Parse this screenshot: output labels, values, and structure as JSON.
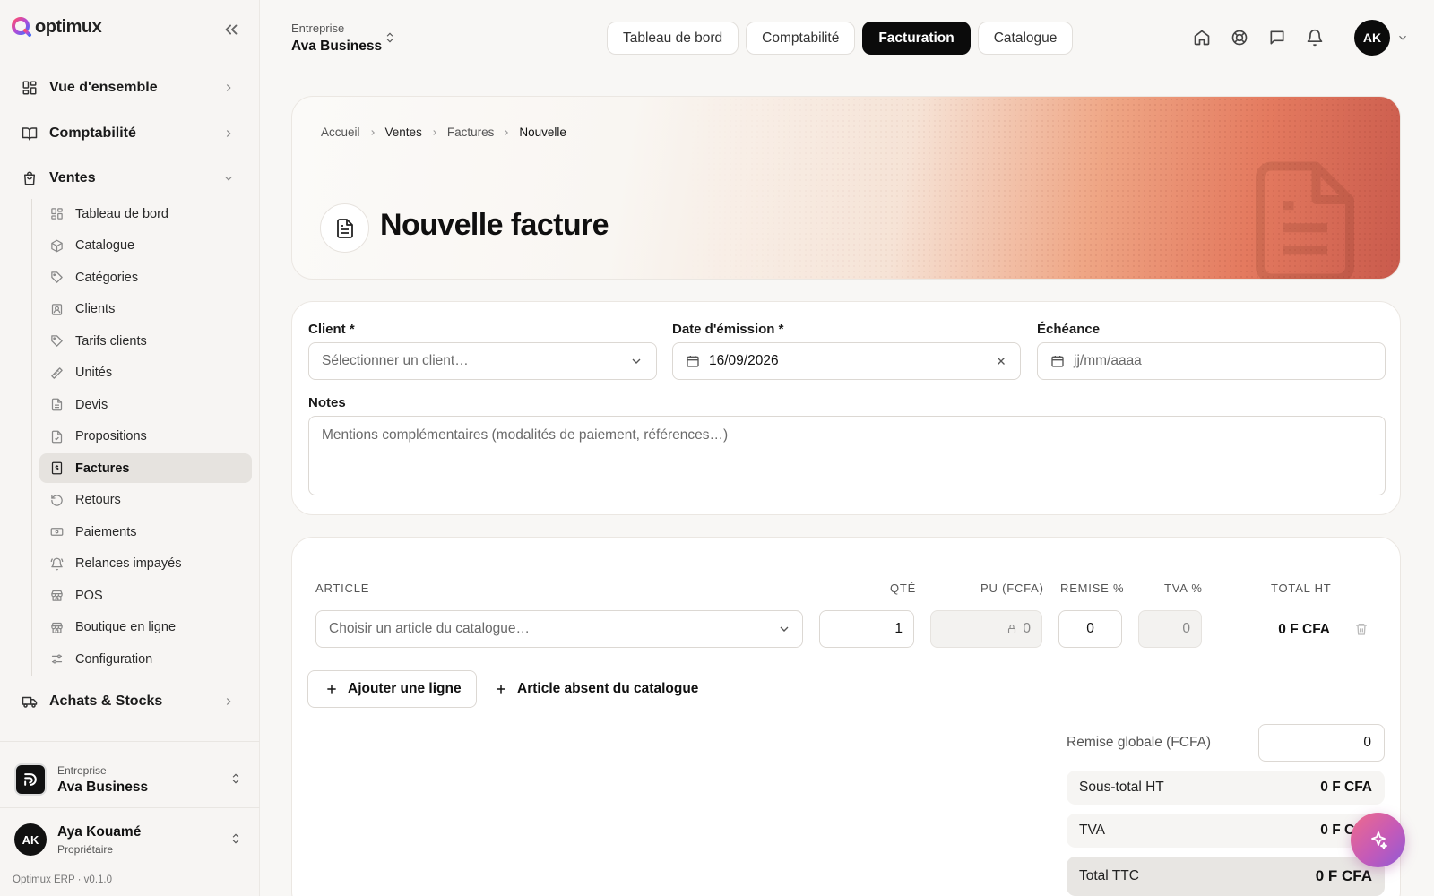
{
  "app": {
    "name": "optimux",
    "version": "Optimux ERP · v0.1.0"
  },
  "sidebar": {
    "top_items": [
      {
        "label": "Vue d'ensemble",
        "icon": "layout-grid-icon"
      },
      {
        "label": "Comptabilité",
        "icon": "book-open-icon"
      },
      {
        "label": "Ventes",
        "icon": "shopping-bag-icon",
        "expanded": true
      }
    ],
    "sub_items": [
      {
        "label": "Tableau de bord",
        "icon": "layout-grid-icon"
      },
      {
        "label": "Catalogue",
        "icon": "package-icon"
      },
      {
        "label": "Catégories",
        "icon": "tag-icon"
      },
      {
        "label": "Clients",
        "icon": "contact-icon"
      },
      {
        "label": "Tarifs clients",
        "icon": "tag-icon"
      },
      {
        "label": "Unités",
        "icon": "ruler-icon"
      },
      {
        "label": "Devis",
        "icon": "file-text-icon"
      },
      {
        "label": "Propositions",
        "icon": "file-check-icon"
      },
      {
        "label": "Factures",
        "icon": "receipt-icon",
        "active": true
      },
      {
        "label": "Retours",
        "icon": "rotate-ccw-icon"
      },
      {
        "label": "Paiements",
        "icon": "banknote-icon"
      },
      {
        "label": "Relances impayés",
        "icon": "bell-ring-icon"
      },
      {
        "label": "POS",
        "icon": "store-icon"
      },
      {
        "label": "Boutique en ligne",
        "icon": "store-icon"
      },
      {
        "label": "Configuration",
        "icon": "sliders-icon"
      }
    ],
    "bottom_item": {
      "label": "Achats & Stocks",
      "icon": "truck-icon"
    },
    "company": {
      "caption": "Entreprise",
      "name": "Ava Business"
    },
    "user": {
      "initials": "AK",
      "name": "Aya Kouamé",
      "role": "Propriétaire"
    }
  },
  "header": {
    "company": {
      "caption": "Entreprise",
      "name": "Ava Business"
    },
    "tabs": [
      {
        "label": "Tableau de bord"
      },
      {
        "label": "Comptabilité"
      },
      {
        "label": "Facturation",
        "active": true
      },
      {
        "label": "Catalogue"
      }
    ],
    "icons": [
      "home-icon",
      "help-buoy-icon",
      "message-icon",
      "bell-icon"
    ],
    "avatar_initials": "AK"
  },
  "hero": {
    "breadcrumb": [
      "Accueil",
      "Ventes",
      "Factures",
      "Nouvelle"
    ],
    "title": "Nouvelle facture"
  },
  "form": {
    "client": {
      "label": "Client *",
      "placeholder": "Sélectionner un client…"
    },
    "issue_date": {
      "label": "Date d'émission *",
      "value": "16/09/2026"
    },
    "due_date": {
      "label": "Échéance",
      "placeholder": "jj/mm/aaaa"
    },
    "notes": {
      "label": "Notes",
      "placeholder": "Mentions complémentaires (modalités de paiement, références…)"
    }
  },
  "lines": {
    "columns": [
      "ARTICLE",
      "QTÉ",
      "PU (FCFA)",
      "REMISE %",
      "TVA %",
      "TOTAL HT"
    ],
    "row": {
      "article_placeholder": "Choisir un article du catalogue…",
      "qty": "1",
      "unit_price": "0",
      "discount": "0",
      "vat": "0",
      "total": "0 F CFA"
    },
    "add_line_label": "Ajouter une ligne",
    "add_custom_label": "Article absent du catalogue"
  },
  "totals": {
    "global_discount_label": "Remise globale (FCFA)",
    "global_discount_value": "0",
    "subtotal_label": "Sous-total HT",
    "subtotal_value": "0 F CFA",
    "vat_label": "TVA",
    "vat_value": "0 F CFA",
    "grand_label": "Total TTC",
    "grand_value": "0 F CFA"
  },
  "colors": {
    "accent": "#0b0b0b",
    "hero_warm": "#e47a5f",
    "fab_start": "#f06b8b",
    "fab_end": "#8f5bd6"
  }
}
